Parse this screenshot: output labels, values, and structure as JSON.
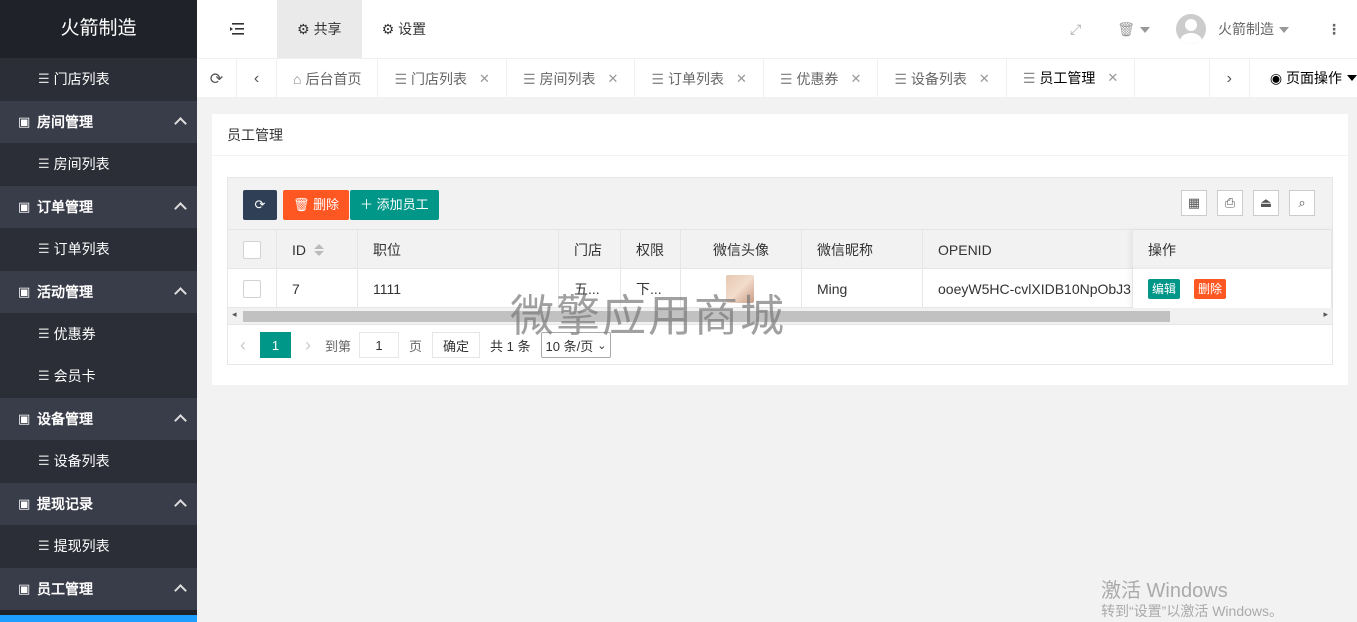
{
  "app": {
    "title": "火箭制造"
  },
  "sidebar": {
    "items": [
      {
        "type": "item",
        "label": "门店列表"
      },
      {
        "type": "group",
        "label": "房间管理",
        "icon": "home-icon"
      },
      {
        "type": "item",
        "label": "房间列表"
      },
      {
        "type": "group",
        "label": "订单管理",
        "icon": "search-doc-icon"
      },
      {
        "type": "item",
        "label": "订单列表"
      },
      {
        "type": "group",
        "label": "活动管理",
        "icon": "gift-icon"
      },
      {
        "type": "item",
        "label": "优惠券"
      },
      {
        "type": "item",
        "label": "会员卡"
      },
      {
        "type": "group",
        "label": "设备管理",
        "icon": "device-icon"
      },
      {
        "type": "item",
        "label": "设备列表"
      },
      {
        "type": "group",
        "label": "提现记录",
        "icon": "edit-icon"
      },
      {
        "type": "item",
        "label": "提现列表"
      },
      {
        "type": "group",
        "label": "员工管理",
        "icon": "edit-icon"
      }
    ]
  },
  "header": {
    "share": "共享",
    "settings": "设置",
    "user": "火箭制造"
  },
  "tabs": {
    "items": [
      {
        "label": "后台首页"
      },
      {
        "label": "门店列表"
      },
      {
        "label": "房间列表"
      },
      {
        "label": "订单列表"
      },
      {
        "label": "优惠券"
      },
      {
        "label": "设备列表"
      },
      {
        "label": "员工管理"
      }
    ],
    "page_ops": "页面操作"
  },
  "panel": {
    "title": "员工管理"
  },
  "toolbar": {
    "delete": "删除",
    "add": "添加员工"
  },
  "table": {
    "headers": {
      "id": "ID",
      "position": "职位",
      "store": "门店",
      "perm": "权限",
      "avatar": "微信头像",
      "nick": "微信昵称",
      "openid": "OPENID",
      "ops": "操作"
    },
    "row": {
      "id": "7",
      "position": "1111",
      "store": "五...",
      "perm": "下...",
      "nick": "Ming",
      "openid": "ooeyW5HC-cvlXIDB10NpObJ3",
      "edit": "编辑",
      "del": "删除"
    }
  },
  "pager": {
    "current": "1",
    "goto": "到第",
    "page_input": "1",
    "page_unit": "页",
    "confirm": "确定",
    "total": "共 1 条",
    "size": "10 条/页"
  },
  "watermark": "微擎应用商城",
  "activation": {
    "line1": "激活 Windows",
    "line2": "转到“设置”以激活 Windows。"
  },
  "colors": {
    "sidebar": "#20222a",
    "group": "#393d49",
    "teal": "#009688",
    "orange": "#ff5722",
    "dark": "#2f4056"
  }
}
